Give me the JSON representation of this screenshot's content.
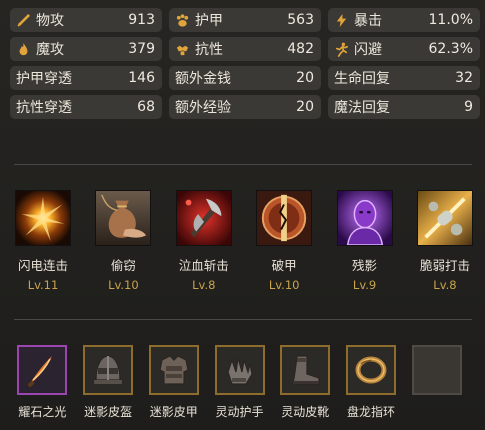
{
  "stats": [
    {
      "icon": "sword-icon",
      "label": "物攻",
      "value": "913"
    },
    {
      "icon": "paw-icon",
      "label": "护甲",
      "value": "563"
    },
    {
      "icon": "lightning-icon",
      "label": "暴击",
      "value": "11.0%"
    },
    {
      "icon": "flame-icon",
      "label": "魔攻",
      "value": "379"
    },
    {
      "icon": "muscle-icon",
      "label": "抗性",
      "value": "482"
    },
    {
      "icon": "running-man-icon",
      "label": "闪避",
      "value": "62.3%"
    },
    {
      "label": "护甲穿透",
      "value": "146"
    },
    {
      "label": "额外金钱",
      "value": "20"
    },
    {
      "label": "生命回复",
      "value": "32"
    },
    {
      "label": "抗性穿透",
      "value": "68"
    },
    {
      "label": "额外经验",
      "value": "20"
    },
    {
      "label": "魔法回复",
      "value": "9"
    }
  ],
  "skills": [
    {
      "name": "闪电连击",
      "level": "Lv.11",
      "icon": "lightning-burst-icon"
    },
    {
      "name": "偷窃",
      "level": "Lv.10",
      "icon": "money-bag-icon"
    },
    {
      "name": "泣血斩击",
      "level": "Lv.8",
      "icon": "bloody-axe-icon"
    },
    {
      "name": "破甲",
      "level": "Lv.10",
      "icon": "broken-shield-icon"
    },
    {
      "name": "残影",
      "level": "Lv.9",
      "icon": "shadow-figure-icon"
    },
    {
      "name": "脆弱打击",
      "level": "Lv.8",
      "icon": "bone-strike-icon"
    }
  ],
  "equipment": [
    {
      "name": "耀石之光",
      "icon": "glowing-blade-icon",
      "rarity": "purple"
    },
    {
      "name": "迷影皮盔",
      "icon": "helmet-icon",
      "rarity": "gold"
    },
    {
      "name": "迷影皮甲",
      "icon": "leather-armor-icon",
      "rarity": "gold"
    },
    {
      "name": "灵动护手",
      "icon": "gauntlet-icon",
      "rarity": "gold"
    },
    {
      "name": "灵动皮靴",
      "icon": "boot-icon",
      "rarity": "gold"
    },
    {
      "name": "盘龙指环",
      "icon": "ring-icon",
      "rarity": "gold"
    },
    {
      "name": "",
      "icon": "empty-slot-icon",
      "rarity": "empty"
    }
  ],
  "colors": {
    "level": "#c9a44b",
    "icon_gold": "#e0a43a",
    "border_gold": "#8e6c2c",
    "border_purple": "#9b46b0"
  }
}
